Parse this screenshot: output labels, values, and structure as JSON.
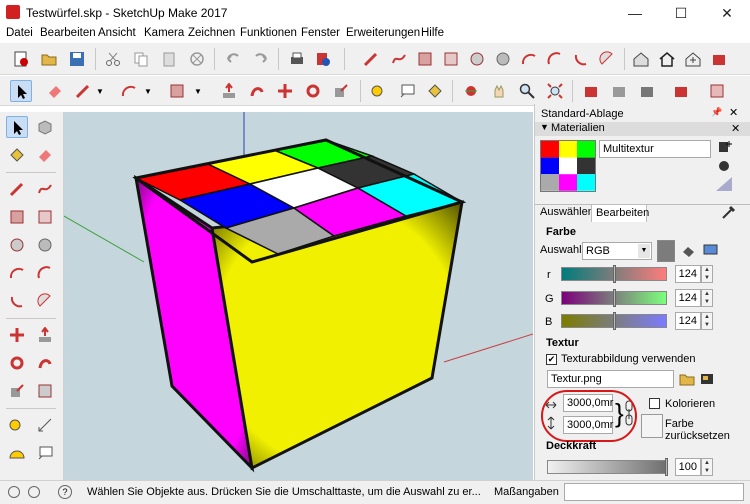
{
  "window": {
    "title": "Testwürfel.skp - SketchUp Make 2017",
    "minimize": "—",
    "maximize": "☐",
    "close": "✕"
  },
  "menu": [
    "Datei",
    "Bearbeiten",
    "Ansicht",
    "Kamera",
    "Zeichnen",
    "Funktionen",
    "Fenster",
    "Erweiterungen",
    "Hilfe"
  ],
  "colors": {
    "red": "#ff0000",
    "yellow": "#ffff00",
    "green": "#00ff00",
    "blue": "#0000ff",
    "white": "#ffffff",
    "black": "#333333",
    "gray": "#aaaaaa",
    "magenta": "#ff00ff",
    "cyan": "#00ffff",
    "face_side": "#f0f000"
  },
  "panel": {
    "tray_title": "Standard-Ablage",
    "materials_header": "Materialien",
    "material_name": "Multitextur",
    "tabs": [
      "Auswählen",
      "Bearbeiten"
    ],
    "active_tab": "Bearbeiten",
    "farbe_header": "Farbe",
    "auswahl_label": "Auswahl:",
    "color_mode": "RGB",
    "channels": [
      {
        "label": "r",
        "value": "124",
        "level": 0.49
      },
      {
        "label": "G",
        "value": "124",
        "level": 0.49
      },
      {
        "label": "B",
        "value": "124",
        "level": 0.49
      }
    ],
    "textur_header": "Textur",
    "use_texture_label": "Texturabbildung verwenden",
    "use_texture_checked": true,
    "texture_file": "Textur.png",
    "width_value": "3000,0mr",
    "height_value": "3000,0mr",
    "colorize_label": "Kolorieren",
    "reset_color_label": "Farbe zurücksetzen",
    "opacity_header": "Deckkraft",
    "opacity_value": "100",
    "opacity_level": 1.0
  },
  "status": {
    "message": "Wählen Sie Objekte aus. Drücken Sie die Umschalttaste, um die Auswahl zu er...",
    "measure_label": "Maßangaben"
  }
}
